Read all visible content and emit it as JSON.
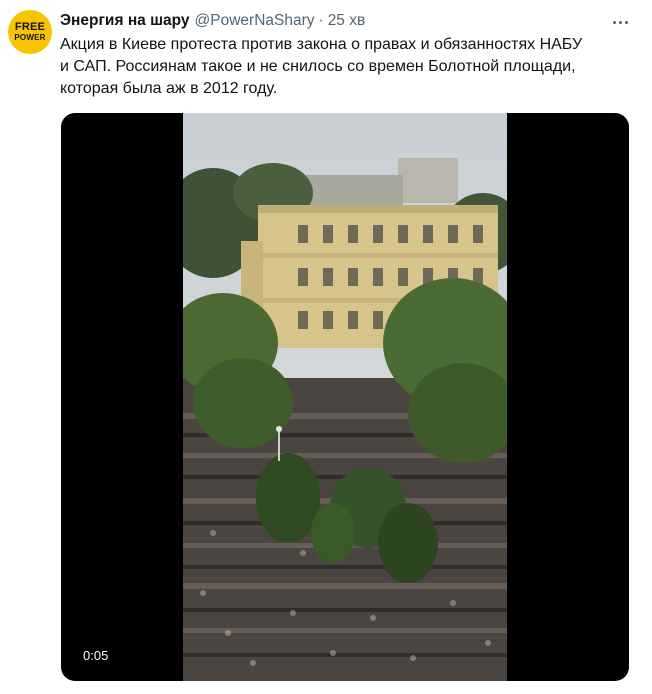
{
  "tweet": {
    "avatar_text_1": "FREE",
    "avatar_text_2": "POWER",
    "display_name": "Энергия на шару",
    "handle": "@PowerNaShary",
    "separator": "·",
    "time": "25 хв",
    "text": "Акция в Киеве протеста против закона о правах и обязанностях НАБУ\nи САП. Россиянам такое и не снилось со времен Болотной площади,\nкоторая была аж в 2012 году.",
    "video_duration": "0:05"
  },
  "colors": {
    "avatar_bg": "#f7c600",
    "secondary_text": "#536471",
    "media_bg": "#000000"
  }
}
